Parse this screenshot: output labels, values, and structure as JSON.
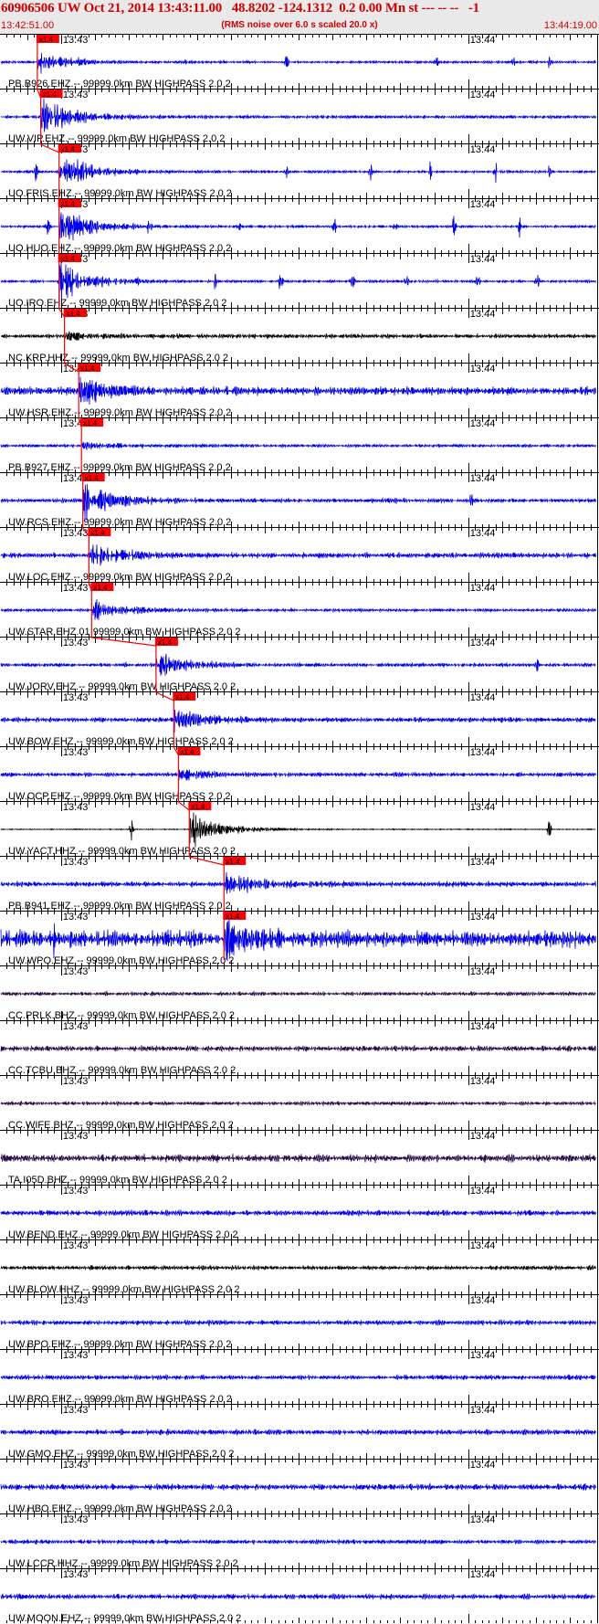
{
  "header": {
    "title": "60906506 UW Oct 21, 2014 13:43:11.00   48.8202 -124.1312  0.2 0.00 Mn st --- -- --   -1",
    "subtitle": "(RMS noise over 6.0 s scaled 20.0 x)",
    "start_time": "13:42:51.00",
    "end_time": "13:44:19.00"
  },
  "colors": {
    "header_text": "#d00000",
    "pick_box": "#ff0000",
    "blue_trace": "#0000ee",
    "black_trace": "#000000",
    "purple_trace": "#2a0a4a"
  },
  "chart_data": {
    "type": "line",
    "title": "60906506 UW Oct 21, 2014 13:43:11.00   48.8202 -124.1312  0.2 0.00 Mn st --- -- --   -1",
    "time_start": "13:42:51.00",
    "time_end": "13:44:19.00",
    "time_ticks": [
      "13:43",
      "13:44"
    ],
    "pick_label": "x1.4",
    "traces": [
      {
        "station": "PB.B926.EHZ.--",
        "label": "PB.B926.EHZ.-- 99999.0km BW  HIGHPASS  2.0  2",
        "color": "blue",
        "pick": "13:42:56.5",
        "amp": 0.55,
        "noise": 0.05,
        "spikes": [
          0.31,
          0.48,
          0.73,
          0.86,
          0.92
        ]
      },
      {
        "station": "UW.VIP.EHZ.--",
        "label": "UW.VIP.EHZ.-- 99999.0km BW  HIGHPASS  2.0  2",
        "color": "blue",
        "pick": "13:42:57.0",
        "amp": 0.95,
        "noise": 0.06,
        "spikes": []
      },
      {
        "station": "UO.FRIS.EHZ.--",
        "label": "UO.FRIS.EHZ.-- 99999.0km BW  HIGHPASS  2.0  2",
        "color": "blue",
        "pick": "13:42:59.7",
        "amp": 0.9,
        "noise": 0.05,
        "spikes": [
          0.06,
          0.48,
          0.62,
          0.72,
          0.83,
          0.92
        ]
      },
      {
        "station": "UO.HUO.EHZ.--",
        "label": "UO.HUO.EHZ.-- 99999.0km BW  HIGHPASS  2.0  2",
        "color": "blue",
        "pick": "13:42:59.7",
        "amp": 0.95,
        "noise": 0.05,
        "spikes": [
          0.08,
          0.25,
          0.4,
          0.56,
          0.66,
          0.76,
          0.87
        ]
      },
      {
        "station": "UO.IRO.EHZ.--",
        "label": "UO.IRO.EHZ.-- 99999.0km BW  HIGHPASS  2.0  2",
        "color": "blue",
        "pick": "13:42:59.7",
        "amp": 0.95,
        "noise": 0.05,
        "spikes": [
          0.1,
          0.23,
          0.36,
          0.47,
          0.59,
          0.68,
          0.8,
          0.9
        ]
      },
      {
        "station": "NC.KRP.HHZ.--",
        "label": "NC.KRP.HHZ.-- 99999.0km BW  HIGHPASS  2.0  2",
        "color": "black",
        "pick": "13:43:00.5",
        "amp": 0.3,
        "noise": 0.08,
        "spikes": []
      },
      {
        "station": "UW.HSR.EHZ.--",
        "label": "UW.HSR.EHZ.-- 99999.0km BW  HIGHPASS  2.0  2",
        "color": "blue",
        "pick": "13:43:02.6",
        "amp": 0.8,
        "noise": 0.15,
        "spikes": []
      },
      {
        "station": "PB.B927.EHZ.--",
        "label": "PB.B927.EHZ.-- 99999.0km BW  HIGHPASS  2.0  2",
        "color": "blue",
        "pick": "13:43:03.0",
        "amp": 0.2,
        "noise": 0.06,
        "spikes": []
      },
      {
        "station": "UW.RCS.EHZ.--",
        "label": "UW.RCS.EHZ.-- 99999.0km BW  HIGHPASS  2.0  2",
        "color": "blue",
        "pick": "13:43:03.2",
        "amp": 0.95,
        "noise": 0.08,
        "spikes": [
          0.79
        ]
      },
      {
        "station": "UW.LOC.EHZ.--",
        "label": "UW.LOC.EHZ.-- 99999.0km BW  HIGHPASS  2.0  2",
        "color": "blue",
        "pick": "13:43:04.1",
        "amp": 0.6,
        "noise": 0.1,
        "spikes": []
      },
      {
        "station": "UW.STAR.EHZ.01",
        "label": "UW.STAR.EHZ.01 99999.0km BW  HIGHPASS  2.0  2",
        "color": "blue",
        "pick": "13:43:04.5",
        "amp": 0.5,
        "noise": 0.06,
        "spikes": []
      },
      {
        "station": "UW.JORV.EHZ.--",
        "label": "UW.JORV.EHZ.-- 99999.0km BW  HIGHPASS  2.0  2",
        "color": "blue",
        "pick": "13:43:14.0",
        "amp": 0.55,
        "noise": 0.07,
        "spikes": [
          0.9
        ]
      },
      {
        "station": "UW.BOW.EHZ.--",
        "label": "UW.BOW.EHZ.-- 99999.0km BW  HIGHPASS  2.0  2",
        "color": "blue",
        "pick": "13:43:16.6",
        "amp": 0.55,
        "noise": 0.09,
        "spikes": []
      },
      {
        "station": "UW.OCP.EHZ.--",
        "label": "UW.OCP.EHZ.-- 99999.0km BW  HIGHPASS  2.0  2",
        "color": "blue",
        "pick": "13:43:17.3",
        "amp": 0.35,
        "noise": 0.08,
        "spikes": []
      },
      {
        "station": "UW.YACT.HHZ.--",
        "label": "UW.YACT.HHZ.-- 99999.0km BW  HIGHPASS  2.0  2",
        "color": "black",
        "pick": "13:43:18.9",
        "amp": 0.95,
        "noise": 0.02,
        "spikes": [
          0.22,
          0.92
        ]
      },
      {
        "station": "PB.B941.EHZ.--",
        "label": "PB.B941.EHZ.-- 99999.0km BW  HIGHPASS  2.0  2",
        "color": "blue",
        "pick": "13:43:24.0",
        "amp": 0.55,
        "noise": 0.1,
        "spikes": []
      },
      {
        "station": "UW.WPO.EHZ.--",
        "label": "UW.WPO.EHZ.-- 99999.0km BW  HIGHPASS  2.0  2",
        "color": "blue",
        "pick": "13:43:24.0",
        "amp": 0.95,
        "noise": 0.3,
        "spikes": [
          0.09
        ]
      },
      {
        "station": "CC.PRLK.BHZ.--",
        "label": "CC.PRLK.BHZ.-- 99999.0km BW  HIGHPASS  2.0  2",
        "color": "purple",
        "pick": "",
        "amp": 0.1,
        "noise": 0.07,
        "spikes": []
      },
      {
        "station": "CC.TCBU.BHZ.--",
        "label": "CC.TCBU.BHZ.-- 99999.0km BW  HIGHPASS  2.0  2",
        "color": "purple",
        "pick": "",
        "amp": 0.15,
        "noise": 0.1,
        "spikes": []
      },
      {
        "station": "CC.WIFE.BHZ.--",
        "label": "CC.WIFE.BHZ.-- 99999.0km BW  HIGHPASS  2.0  2",
        "color": "purple",
        "pick": "",
        "amp": 0.1,
        "noise": 0.07,
        "spikes": []
      },
      {
        "station": "TA.I05D.BHZ.--",
        "label": "TA.I05D.BHZ.-- 99999.0km BW  HIGHPASS  2.0  2",
        "color": "purple",
        "pick": "",
        "amp": 0.45,
        "noise": 0.14,
        "spikes": []
      },
      {
        "station": "UW.BEND.EHZ.--",
        "label": "UW.BEND.EHZ.-- 99999.0km BW  HIGHPASS  2.0  2",
        "color": "blue",
        "pick": "",
        "amp": 0.4,
        "noise": 0.1,
        "spikes": []
      },
      {
        "station": "UW.BLOW.HHZ.--",
        "label": "UW.BLOW.HHZ.-- 99999.0km BW  HIGHPASS  2.0  2",
        "color": "black",
        "pick": "",
        "amp": 0.1,
        "noise": 0.08,
        "spikes": []
      },
      {
        "station": "UW.BPO.EHZ.--",
        "label": "UW.BPO.EHZ.-- 99999.0km BW  HIGHPASS  2.0  2",
        "color": "blue",
        "pick": "",
        "amp": 0.1,
        "noise": 0.09,
        "spikes": []
      },
      {
        "station": "UW.BRO.EHZ.--",
        "label": "UW.BRO.EHZ.-- 99999.0km BW  HIGHPASS  2.0  2",
        "color": "blue",
        "pick": "",
        "amp": 0.1,
        "noise": 0.09,
        "spikes": []
      },
      {
        "station": "UW.GMO.EHZ.--",
        "label": "UW.GMO.EHZ.-- 99999.0km BW  HIGHPASS  2.0  2",
        "color": "blue",
        "pick": "",
        "amp": 0.1,
        "noise": 0.1,
        "spikes": []
      },
      {
        "station": "UW.HBO.EHZ.--",
        "label": "UW.HBO.EHZ.-- 99999.0km BW  HIGHPASS  2.0  2",
        "color": "blue",
        "pick": "",
        "amp": 0.1,
        "noise": 0.11,
        "spikes": []
      },
      {
        "station": "UW.LCCR.HHZ.--",
        "label": "UW.LCCR.HHZ.-- 99999.0km BW  HIGHPASS  2.0  2",
        "color": "blue",
        "pick": "",
        "amp": 0.1,
        "noise": 0.08,
        "spikes": []
      },
      {
        "station": "UW.MOON.EHZ.--",
        "label": "UW.MOON.EHZ.-- 99999.0km BW  HIGHPASS  2.0  2",
        "color": "blue",
        "pick": "",
        "amp": 0.1,
        "noise": 0.1,
        "spikes": []
      }
    ]
  }
}
